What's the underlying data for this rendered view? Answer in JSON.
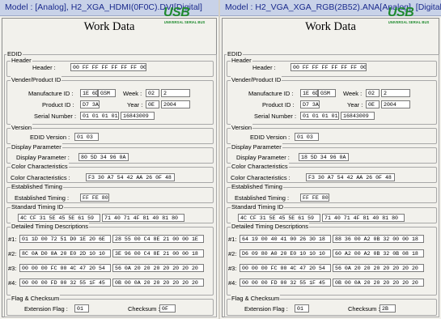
{
  "left": {
    "model": "Model : [Analog],  H2_XGA_HDMI(0F0C).DVI[Digital]",
    "title": "Work Data",
    "logo": {
      "text": "USB",
      "subtitle": "UNIVERSAL SERIAL BUS"
    },
    "edid_legend": "EDID",
    "header": {
      "legend": "Header",
      "label": "Header :",
      "value": "00 FF FF FF FF FF FF 00"
    },
    "vendor": {
      "legend": "Vender/Product ID",
      "manufacture_label": "Manufacture ID :",
      "manufacture_hex": "1E 6D",
      "manufacture_code": "GSM",
      "week_label": "Week :",
      "week_hex": "02",
      "week_dec": "2",
      "product_label": "Product ID :",
      "product_value": "D7 3A",
      "year_label": "Year :",
      "year_hex": "0E",
      "year_dec": "2004",
      "serial_label": "Serial Number :",
      "serial_hex": "01 01 01 01",
      "serial_dec": "16843009"
    },
    "version": {
      "legend": "Version",
      "label": "EDID Version :",
      "value": "01 03"
    },
    "display": {
      "legend": "Display Parameter",
      "label": "Display Parameter :",
      "value": "80 5D 34 96 0A"
    },
    "color": {
      "legend": "Color Characteristics",
      "label": "Color Characteristics :",
      "value": "F3 30 A7 54 42 AA 26 0F 48 4C"
    },
    "established": {
      "legend": "Established Timing",
      "label": "Established Timing :",
      "value": "FF FE 80"
    },
    "standard": {
      "legend": "Standard Timing ID",
      "value1": "4C CF 31 5E 45 5E 61 59",
      "value2": "71 40 71 4F 81 40 81 80"
    },
    "detailed": {
      "legend": "Detailed Timing Descriptions",
      "rows": [
        {
          "label": "#1:",
          "a": "01 1D 00 72 51 D0 1E 20 6E",
          "b": "28 55 00 C4 8E 21 00 00 1E"
        },
        {
          "label": "#2:",
          "a": "8C 0A D0 8A 20 E0 2D 10 10",
          "b": "3E 96 00 C4 8E 21 00 00 18"
        },
        {
          "label": "#3:",
          "a": "00 00 00 FC 00 4C 47 20 54",
          "b": "56 0A 20 20 20 20 20 20 20"
        },
        {
          "label": "#4:",
          "a": "00 00 00 FD 00 32 55 1F 45",
          "b": "0B 00 0A 20 20 20 20 20 20"
        }
      ]
    },
    "flag": {
      "legend": "Flag & Checksum",
      "ext_label": "Extension Flag :",
      "ext_value": "01",
      "checksum_label": "Checksum :",
      "checksum_value": "0F"
    }
  },
  "right": {
    "model": "Model : H2_VGA_XGA_RGB(2B52).ANA[Analog],  [Digital]",
    "title": "Work Data",
    "logo": {
      "text": "USB",
      "subtitle": "UNIVERSAL SERIAL BUS"
    },
    "edid_legend": "EDID",
    "header": {
      "legend": "Header",
      "label": "Header :",
      "value": "00 FF FF FF FF FF FF 00"
    },
    "vendor": {
      "legend": "Vender/Product ID",
      "manufacture_label": "Manufacture ID :",
      "manufacture_hex": "1E 6D",
      "manufacture_code": "GSM",
      "week_label": "Week :",
      "week_hex": "02",
      "week_dec": "2",
      "product_label": "Product ID :",
      "product_value": "D7 3A",
      "year_label": "Year :",
      "year_hex": "0E",
      "year_dec": "2004",
      "serial_label": "Serial Number :",
      "serial_hex": "01 01 01 01",
      "serial_dec": "16843009"
    },
    "version": {
      "legend": "Version",
      "label": "EDID Version :",
      "value": "01 03"
    },
    "display": {
      "legend": "Display Parameter",
      "label": "Display Parameter :",
      "value": "18 5D 34 96 0A"
    },
    "color": {
      "legend": "Color Characteristics",
      "label": "Color Characteristics :",
      "value": "F3 30 A7 54 42 AA 26 0F 48 4C"
    },
    "established": {
      "legend": "Established Timing",
      "label": "Established Timing :",
      "value": "FF FE 80"
    },
    "standard": {
      "legend": "Standard Timing ID",
      "value1": "4C CF 31 5E 45 5E 61 59",
      "value2": "71 40 71 4F 81 40 81 80"
    },
    "detailed": {
      "legend": "Detailed Timing Descriptions",
      "rows": [
        {
          "label": "#1:",
          "a": "64 19 00 40 41 00 26 30 18",
          "b": "88 36 00 A2 0B 32 00 00 18"
        },
        {
          "label": "#2:",
          "a": "D6 09 80 A0 20 E0 10 10 10",
          "b": "60 A2 00 A2 0B 32 0B 08 18"
        },
        {
          "label": "#3:",
          "a": "00 00 00 FC 00 4C 47 20 54",
          "b": "56 0A 20 20 20 20 20 20 20"
        },
        {
          "label": "#4:",
          "a": "00 00 00 FD 00 32 55 1F 45",
          "b": "0B 00 0A 20 20 20 20 20 20"
        }
      ]
    },
    "flag": {
      "legend": "Flag & Checksum",
      "ext_label": "Extension Flag :",
      "ext_value": "01",
      "checksum_label": "Checksum :",
      "checksum_value": "2B"
    }
  },
  "colors": {
    "titlebar_bg": "#c8d2e8",
    "titlebar_text": "#1a2a8c",
    "usb_logo": "#1f8a2e",
    "panel_bg": "#f2f1ec"
  }
}
